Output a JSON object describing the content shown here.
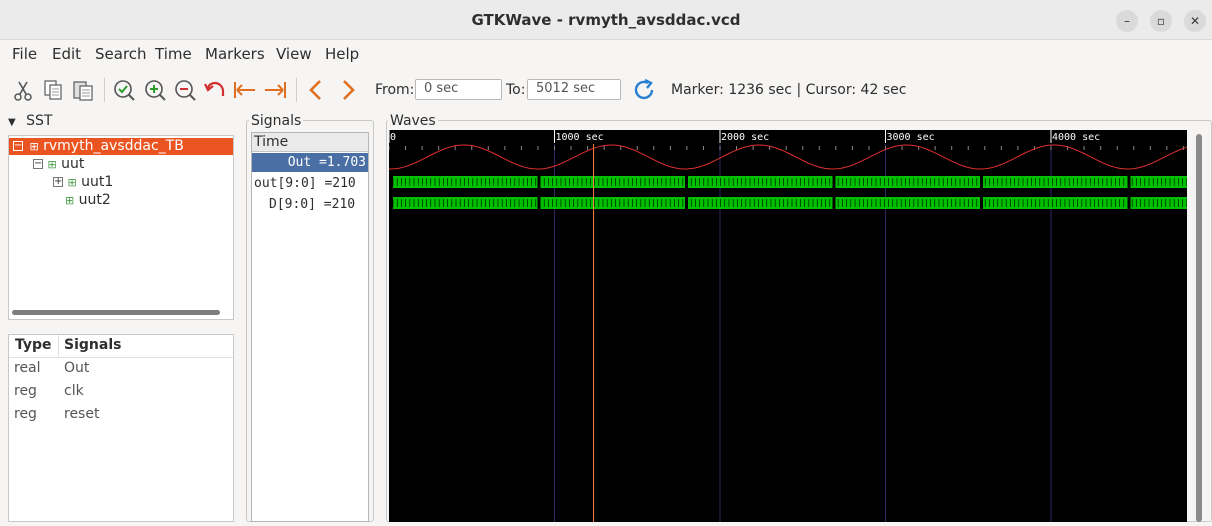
{
  "window": {
    "title": "GTKWave - rvmyth_avsddac.vcd",
    "minimize": "–",
    "maximize": "▫",
    "close": "✕"
  },
  "menu": [
    "File",
    "Edit",
    "Search",
    "Time",
    "Markers",
    "View",
    "Help"
  ],
  "toolbar": {
    "icons": [
      "cut-icon",
      "copy-icon",
      "paste-icon",
      "zoom-fit-icon",
      "zoom-in-icon",
      "zoom-out-icon",
      "undo-icon",
      "zoom-start-icon",
      "zoom-end-icon",
      "prev-icon",
      "next-icon",
      "reload-icon"
    ],
    "from_label": "From:",
    "from_value": "0 sec",
    "to_label": "To:",
    "to_value": "5012 sec",
    "status": "Marker: 1236 sec  |  Cursor: 42 sec"
  },
  "sst": {
    "header": "SST",
    "tree": [
      {
        "label": "rvmyth_avsddac_TB",
        "selected": true
      },
      {
        "label": "uut",
        "selected": false
      },
      {
        "label": "uut1",
        "selected": false
      },
      {
        "label": "uut2",
        "selected": false
      }
    ],
    "table": {
      "col_type": "Type",
      "col_signals": "Signals",
      "rows": [
        {
          "type": "real",
          "name": "Out"
        },
        {
          "type": "reg",
          "name": "clk"
        },
        {
          "type": "reg",
          "name": "reset"
        }
      ]
    }
  },
  "signals": {
    "header": "Signals",
    "time_label": "Time",
    "rows": [
      "Out =1.703",
      "out[9:0] =210",
      "D[9:0] =210"
    ]
  },
  "waves": {
    "header": "Waves",
    "ticks": [
      "0",
      "1000 sec",
      "2000 sec",
      "3000 sec",
      "4000 sec"
    ],
    "colors": {
      "bg": "#000000",
      "analog": "#e03030",
      "bus": "#00c000",
      "cursor": "#ff8040",
      "grid": "#2a2a66"
    }
  }
}
